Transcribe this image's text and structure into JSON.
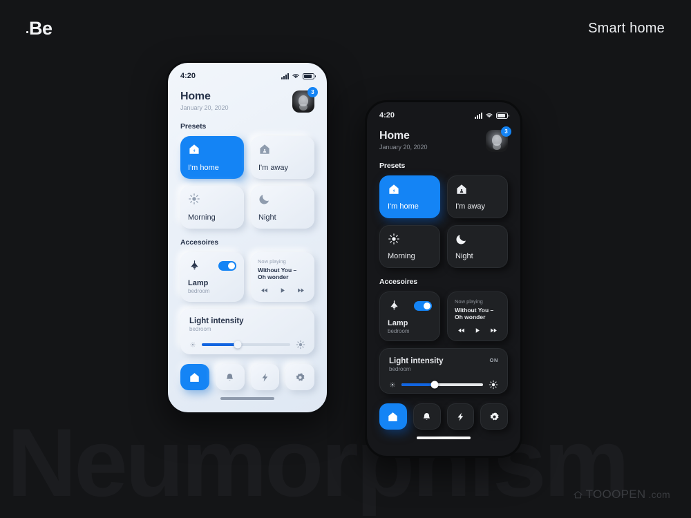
{
  "page": {
    "brand": "Be",
    "title": "Smart home",
    "watermark": "Neumorphism",
    "credit": "TOOOPEN",
    "credit_suffix": ".com",
    "accent": "#1484f5",
    "bg": "#141517"
  },
  "phone": {
    "statusbar": {
      "time": "4:20",
      "signal_icon": "signal-bars-icon",
      "wifi_icon": "wifi-icon",
      "battery_icon": "battery-icon"
    },
    "header": {
      "title": "Home",
      "date": "January 20, 2020",
      "avatar_icon": "avatar",
      "badge_count": "3"
    },
    "sections": {
      "presets": "Presets",
      "accessoires": "Accesoires"
    },
    "presets": [
      {
        "label": "I'm home",
        "icon": "house-bolt-icon",
        "active": true
      },
      {
        "label": "I'm away",
        "icon": "house-person-icon",
        "active": false
      },
      {
        "label": "Morning",
        "icon": "sun-icon",
        "active": false
      },
      {
        "label": "Night",
        "icon": "moon-icon",
        "active": false
      }
    ],
    "lamp": {
      "icon": "pendant-lamp-icon",
      "name": "Lamp",
      "room": "bedroom",
      "toggle_on": true
    },
    "media": {
      "now_playing": "Now playing",
      "track": "Without You –\nOh wonder",
      "track_line1": "Without You –",
      "track_line2": "Oh wonder",
      "prev_icon": "rewind-icon",
      "play_icon": "play-icon",
      "next_icon": "fast-forward-icon"
    },
    "light_intensity": {
      "title": "Light intensity",
      "room": "bedroom",
      "status": "ON",
      "low_icon": "brightness-low-icon",
      "high_icon": "brightness-high-icon",
      "value_percent": 41
    },
    "nav": [
      {
        "icon": "home-icon",
        "active": true
      },
      {
        "icon": "bell-icon",
        "active": false
      },
      {
        "icon": "bolt-icon",
        "active": false
      },
      {
        "icon": "gear-icon",
        "active": false
      }
    ],
    "home_indicator": "home-indicator"
  }
}
